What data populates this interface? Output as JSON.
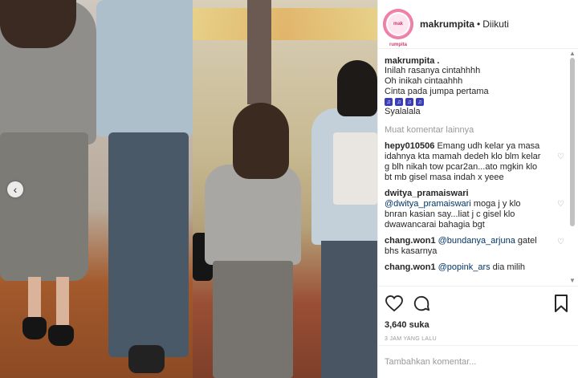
{
  "post": {
    "username": "makrumpita",
    "separator": "•",
    "follow_status": "Diikuti",
    "avatar_text": "mak rumpita"
  },
  "caption": {
    "username": "makrumpita .",
    "lines": [
      "Inilah rasanya cintahhhh",
      "Oh inikah cintaahhh",
      "Cinta pada jumpa pertama"
    ],
    "emoji_glyphs": [
      "♫",
      "♫",
      "♫",
      "♫"
    ],
    "last_line": "Syalalala"
  },
  "more_comments": "Muat komentar lainnya",
  "comments": [
    {
      "user": "hepy010506",
      "mention": "",
      "text": "Emang udh kelar ya masa idahnya kta mamah dedeh klo blm kelar g blh nikah tow pcar2an...ato mgkin klo bt mb gisel masa indah x yeee"
    },
    {
      "user": "dwitya_pramaiswari",
      "mention": "@dwitya_pramaiswari",
      "text": "moga j y klo bnran kasian say...liat j c gisel klo dwawancarai bahagia bgt"
    },
    {
      "user": "chang.won1",
      "mention": "@bundanya_arjuna",
      "text": "gatel bhs kasarnya"
    },
    {
      "user": "chang.won1",
      "mention": "@popink_ars",
      "text": "dia milih"
    }
  ],
  "likes": "3,640 suka",
  "time": "3 JAM YANG LALU",
  "add_comment_placeholder": "Tambahkan komentar...",
  "icons": {
    "carousel_prev": "‹",
    "heart": "heart-icon",
    "comment": "comment-icon",
    "bookmark": "bookmark-icon",
    "comment_like": "♡"
  },
  "scrollbar": {
    "up": "▲",
    "down": "▼"
  }
}
